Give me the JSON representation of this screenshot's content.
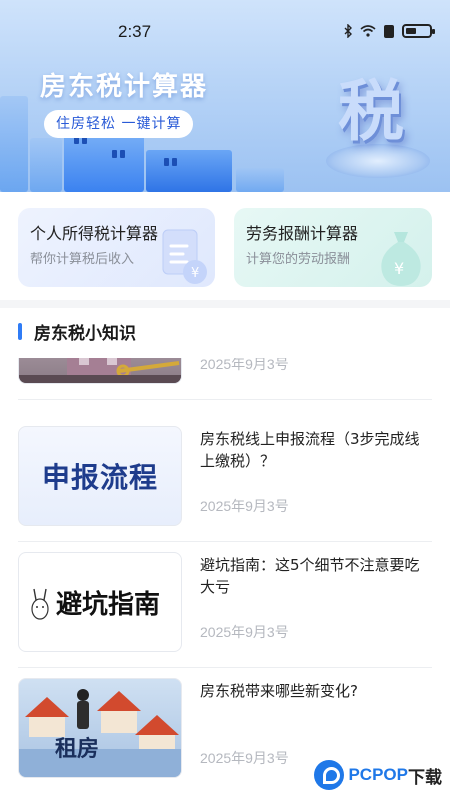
{
  "status_bar": {
    "time": "2:37"
  },
  "hero": {
    "title": "房东税计算器",
    "subtitle": "住房轻松 一键计算",
    "emblem_char": "税"
  },
  "cards": [
    {
      "title": "个人所得税计算器",
      "desc": "帮你计算税后收入"
    },
    {
      "title": "劳务报酬计算器",
      "desc": "计算您的劳动报酬"
    }
  ],
  "section": {
    "title": "房东税小知识"
  },
  "news": [
    {
      "title": "",
      "date": "2025年9月3号",
      "thumb_text": ""
    },
    {
      "title": "房东税线上申报流程（3步完成线上缴税）？",
      "date": "2025年9月3号",
      "thumb_text": "申报流程"
    },
    {
      "title": "避坑指南：这5个细节不注意要吃大亏",
      "date": "2025年9月3号",
      "thumb_text": "避坑指南"
    },
    {
      "title": "房东税带来哪些新变化?",
      "date": "2025年9月3号",
      "thumb_text": "租房"
    }
  ],
  "watermark": {
    "brand": "PCPOP",
    "suffix": "下载"
  },
  "colors": {
    "accent": "#2f7cf6",
    "brand": "#1f78e8"
  }
}
